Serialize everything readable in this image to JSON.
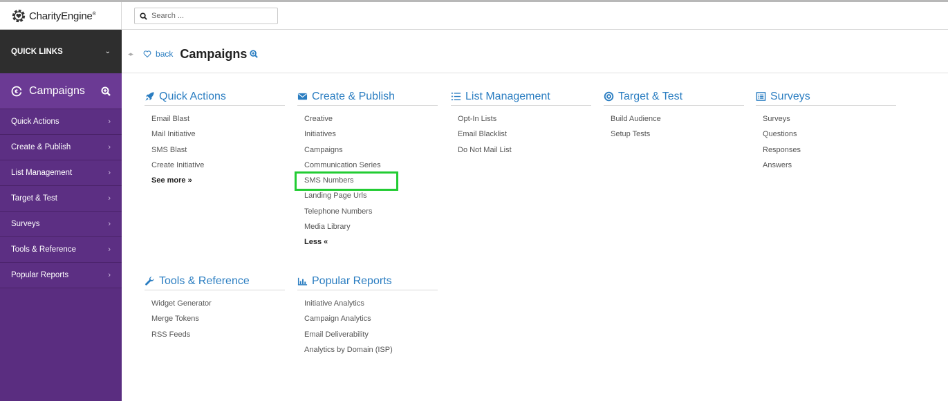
{
  "header": {
    "logo_text": "CharityEngine",
    "logo_mark": "®",
    "search_placeholder": "Search ..."
  },
  "sidebar": {
    "quick_links": "QUICK LINKS",
    "section_title": "Campaigns",
    "items": [
      {
        "label": "Quick Actions"
      },
      {
        "label": "Create & Publish"
      },
      {
        "label": "List Management"
      },
      {
        "label": "Target & Test"
      },
      {
        "label": "Surveys"
      },
      {
        "label": "Tools & Reference"
      },
      {
        "label": "Popular Reports"
      }
    ]
  },
  "breadcrumb": {
    "back": "back",
    "title": "Campaigns"
  },
  "sections": {
    "quick_actions": {
      "title": "Quick Actions",
      "links": [
        "Email Blast",
        "Mail Initiative",
        "SMS Blast",
        "Create Initiative"
      ],
      "more": "See more »"
    },
    "create_publish": {
      "title": "Create & Publish",
      "links": [
        "Creative",
        "Initiatives",
        "Campaigns",
        "Communication Series",
        "SMS Numbers",
        "Landing Page Urls",
        "Telephone Numbers",
        "Media Library"
      ],
      "less": "Less «"
    },
    "list_management": {
      "title": "List Management",
      "links": [
        "Opt-In Lists",
        "Email Blacklist",
        "Do Not Mail List"
      ]
    },
    "target_test": {
      "title": "Target & Test",
      "links": [
        "Build Audience",
        "Setup Tests"
      ]
    },
    "surveys": {
      "title": "Surveys",
      "links": [
        "Surveys",
        "Questions",
        "Responses",
        "Answers"
      ]
    },
    "tools_reference": {
      "title": "Tools & Reference",
      "links": [
        "Widget Generator",
        "Merge Tokens",
        "RSS Feeds"
      ]
    },
    "popular_reports": {
      "title": "Popular Reports",
      "links": [
        "Initiative Analytics",
        "Campaign Analytics",
        "Email Deliverability",
        "Analytics by Domain (ISP)"
      ]
    }
  },
  "colors": {
    "sidebar": "#5a2d80",
    "accent_link": "#2a7dc1",
    "highlight_box": "#22cc33"
  }
}
